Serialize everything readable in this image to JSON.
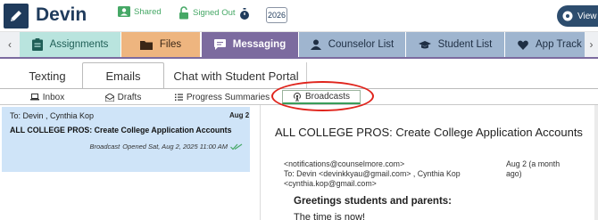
{
  "header": {
    "student_name": "Devin",
    "shared_label": "Shared",
    "signed_out_label": "Signed Out",
    "year": "2026",
    "view_label": "View",
    "brand_color": "#1f3b5c",
    "status_color": "#46a866"
  },
  "tabs": [
    {
      "label": "Assignments",
      "icon": "clipboard-icon",
      "color": "#b9e4de"
    },
    {
      "label": "Files",
      "icon": "folder-icon",
      "color": "#eeb57f"
    },
    {
      "label": "Messaging",
      "icon": "chat-icon",
      "color": "#7c6b9f",
      "active": true
    },
    {
      "label": "Counselor List",
      "icon": "user-icon",
      "color": "#9fb5cf"
    },
    {
      "label": "Student List",
      "icon": "graduation-cap-icon",
      "color": "#9fb5cf"
    },
    {
      "label": "App Track",
      "icon": "heart-icon",
      "color": "#9fb5cf"
    }
  ],
  "subtabs": [
    {
      "label": "Texting"
    },
    {
      "label": "Emails",
      "active": true
    },
    {
      "label": "Chat with Student Portal"
    }
  ],
  "folders": [
    {
      "label": "Inbox",
      "icon": "laptop-icon"
    },
    {
      "label": "Drafts",
      "icon": "envelope-open-icon"
    },
    {
      "label": "Progress Summaries",
      "icon": "list-icon"
    },
    {
      "label": "Broadcasts",
      "icon": "broadcast-icon",
      "active": true
    }
  ],
  "message_list": [
    {
      "to": "To: Devin , Cynthia Kop",
      "date": "Aug 2",
      "subject": "ALL COLLEGE PROS: Create College Application Accounts",
      "type": "Broadcast",
      "status": "Opened Sat, Aug 2, 2025 11:00 AM"
    }
  ],
  "reading_pane": {
    "subject": "ALL COLLEGE PROS: Create College Application Accounts",
    "from": "<notifications@counselmore.com>",
    "to_line1": "To: Devin <devinkkyau@gmail.com> , Cynthia Kop",
    "to_line2": "<cynthia.kop@gmail.com>",
    "date_line1": "Aug 2 (a month",
    "date_line2": "ago)",
    "greeting": "Greetings students and parents:",
    "body_start": "The time is now!"
  },
  "highlight_color": "#e0241c"
}
